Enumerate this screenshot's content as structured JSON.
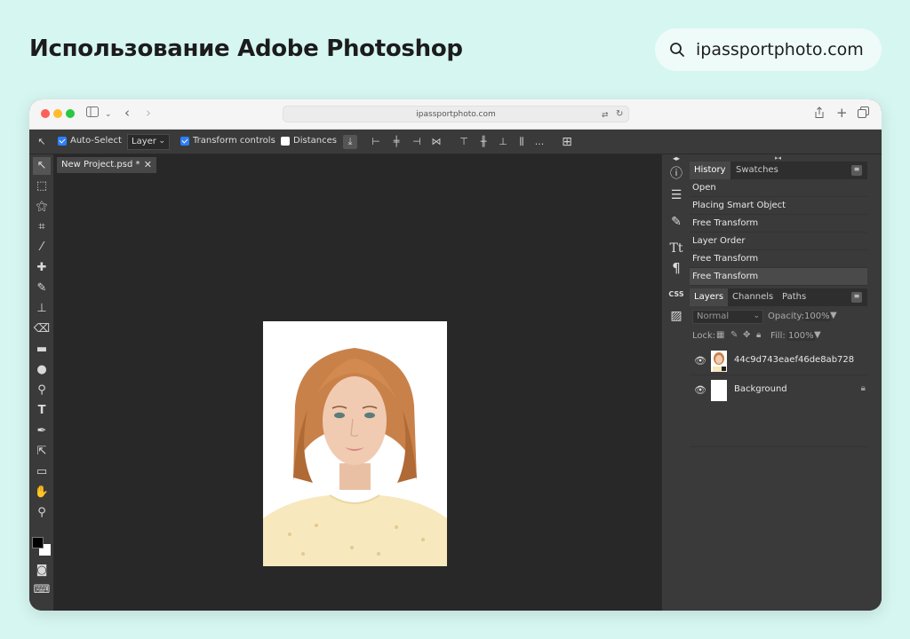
{
  "banner": {
    "title": "Использование Adobe Photoshop",
    "site": "ipassportphoto.com",
    "search_icon": "search-icon"
  },
  "browser": {
    "url": "ipassportphoto.com"
  },
  "options_bar": {
    "auto_select_label": "Auto-Select",
    "auto_select_checked": true,
    "layer_select_value": "Layer",
    "transform_controls_label": "Transform controls",
    "transform_controls_checked": true,
    "distances_label": "Distances",
    "distances_checked": false,
    "more_label": "..."
  },
  "document": {
    "tab_name": "New Project.psd *",
    "close_glyph": "✕"
  },
  "history": {
    "tabs": [
      "History",
      "Swatches"
    ],
    "items": [
      "Open",
      "Placing Smart Object",
      "Free Transform",
      "Layer Order",
      "Free Transform",
      "Free Transform"
    ]
  },
  "layers_panel": {
    "tabs": [
      "Layers",
      "Channels",
      "Paths"
    ],
    "blend_mode": "Normal",
    "opacity_label": "Opacity:",
    "opacity_value": "100%",
    "lock_label": "Lock:",
    "fill_label": "Fill:",
    "fill_value": "100%",
    "layers": [
      {
        "name": "44c9d743eaef46de8ab728",
        "visible": true,
        "locked": false
      },
      {
        "name": "Background",
        "visible": true,
        "locked": true
      }
    ]
  },
  "icon_strip": {
    "css_label": "CSS",
    "text_label": "Tt"
  },
  "colors": {
    "page_bg": "#d6f6f1",
    "app_bg": "#2f2f2f",
    "canvas_bg": "#282828",
    "checkbox_accent": "#2d7ff9"
  }
}
